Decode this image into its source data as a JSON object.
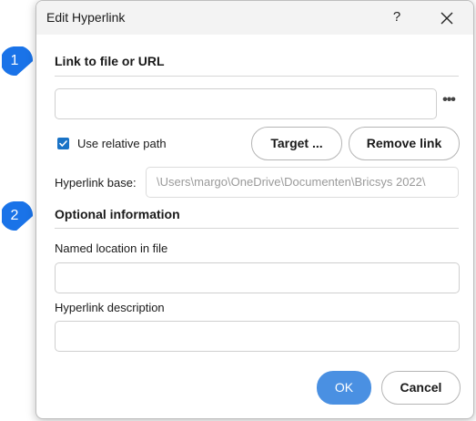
{
  "dialog": {
    "title": "Edit Hyperlink",
    "help_label": "?",
    "close_icon": "close-icon"
  },
  "callouts": {
    "one": "1",
    "two": "2",
    "color": "#1a73e8"
  },
  "link_section": {
    "title": "Link to file or URL",
    "url_value": "",
    "browse_label": "•••",
    "relative_path_label": "Use relative path",
    "relative_path_checked": true,
    "target_button": "Target ...",
    "remove_button": "Remove link",
    "base_label": "Hyperlink base:",
    "base_value": "\\Users\\margo\\OneDrive\\Documenten\\Bricsys 2022\\"
  },
  "optional_section": {
    "title": "Optional information",
    "named_location_label": "Named location in file",
    "named_location_value": "",
    "description_label": "Hyperlink description",
    "description_value": ""
  },
  "footer": {
    "ok_button": "OK",
    "cancel_button": "Cancel"
  },
  "colors": {
    "accent": "#4a90e2",
    "checkbox": "#1a73c6"
  }
}
